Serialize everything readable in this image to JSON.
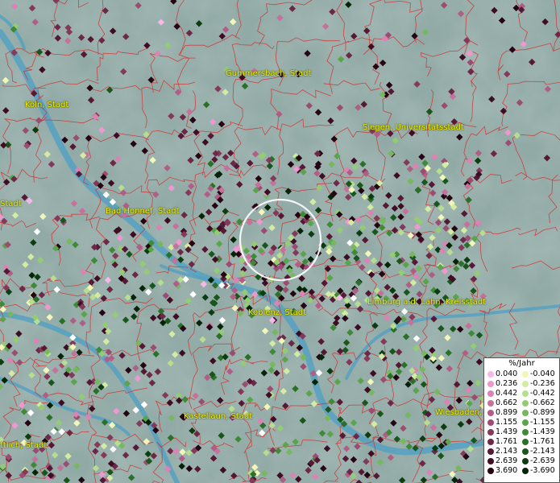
{
  "places": [
    {
      "id": "gummersbach",
      "label": "Gummersbach, Stadt"
    },
    {
      "id": "koeln",
      "label": "Köln, Stadt"
    },
    {
      "id": "siegen",
      "label": "Siegen, Universitätsstadt"
    },
    {
      "id": "bad-honnef",
      "label": "Bad Honnef, Stadt"
    },
    {
      "id": "stadt-left",
      "label": "Stadt"
    },
    {
      "id": "koblenz",
      "label": "Koblenz, Stadt"
    },
    {
      "id": "limburg",
      "label": "Limburg a.d. Lahn, Kreisstadt"
    },
    {
      "id": "wiesbaden",
      "label": "Wiesbaden,"
    },
    {
      "id": "kastellaun",
      "label": "Kastellaun, Stadt"
    },
    {
      "id": "ttlich",
      "label": "ttlich, Stadt"
    }
  ],
  "legend": {
    "title": "%/Jahr",
    "positive": [
      {
        "value": "0.040",
        "color": "#f6b8e6"
      },
      {
        "value": "0.236",
        "color": "#ee98cf"
      },
      {
        "value": "0.442",
        "color": "#dc82b4"
      },
      {
        "value": "0.662",
        "color": "#c7709c"
      },
      {
        "value": "0.899",
        "color": "#b15e86"
      },
      {
        "value": "1.155",
        "color": "#9a4d70"
      },
      {
        "value": "1.439",
        "color": "#84395a"
      },
      {
        "value": "1.761",
        "color": "#6c2847"
      },
      {
        "value": "2.143",
        "color": "#561834"
      },
      {
        "value": "2.639",
        "color": "#3e0d23"
      },
      {
        "value": "3.690",
        "color": "#260411"
      }
    ],
    "negative": [
      {
        "value": "-0.040",
        "color": "#f2f7b8"
      },
      {
        "value": "-0.236",
        "color": "#d3eca2"
      },
      {
        "value": "-0.442",
        "color": "#b6de8e"
      },
      {
        "value": "-0.662",
        "color": "#94cc74"
      },
      {
        "value": "-0.899",
        "color": "#76b85e"
      },
      {
        "value": "-1.155",
        "color": "#5aa44b"
      },
      {
        "value": "-1.439",
        "color": "#3f8a36"
      },
      {
        "value": "-1.761",
        "color": "#2a7028"
      },
      {
        "value": "-2.143",
        "color": "#19561b"
      },
      {
        "value": "-2.639",
        "color": "#0c3d10"
      },
      {
        "value": "-3.690",
        "color": "#042407"
      }
    ]
  },
  "colors": {
    "river": "#4e9fc4",
    "boundary": "#d23030",
    "label": "#f2f000",
    "highlight_ring": "#ffffff"
  }
}
